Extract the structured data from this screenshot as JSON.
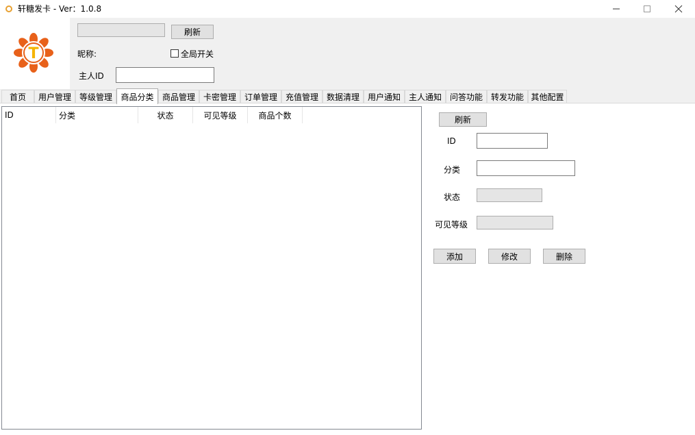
{
  "window": {
    "title": "轩糖发卡 - Ver：1.0.8",
    "minimize_icon": "minimize-icon",
    "maximize_icon": "maximize-icon",
    "close_icon": "close-icon"
  },
  "header": {
    "logo_letter": "T",
    "account_select": "",
    "refresh_label": "刷新",
    "nickname_label": "昵称:",
    "global_switch_label": "全局开关",
    "global_switch_checked": false,
    "owner_id_label": "主人ID",
    "owner_id_value": ""
  },
  "tabs": [
    {
      "label": "首页"
    },
    {
      "label": "用户管理"
    },
    {
      "label": "等级管理"
    },
    {
      "label": "商品分类"
    },
    {
      "label": "商品管理"
    },
    {
      "label": "卡密管理"
    },
    {
      "label": "订单管理"
    },
    {
      "label": "充值管理"
    },
    {
      "label": "数据清理"
    },
    {
      "label": "用户通知"
    },
    {
      "label": "主人通知"
    },
    {
      "label": "问答功能"
    },
    {
      "label": "转发功能"
    },
    {
      "label": "其他配置"
    }
  ],
  "active_tab": "商品分类",
  "table": {
    "columns": [
      "ID",
      "分类",
      "状态",
      "可见等级",
      "商品个数"
    ],
    "rows": []
  },
  "form": {
    "refresh_label": "刷新",
    "id_label": "ID",
    "id_value": "",
    "category_label": "分类",
    "category_value": "",
    "status_label": "状态",
    "status_value": "",
    "level_label": "可见等级",
    "level_value": "",
    "add_label": "添加",
    "edit_label": "修改",
    "delete_label": "删除"
  },
  "colors": {
    "logo_orange": "#e8611a",
    "logo_yellow": "#f5b400",
    "window_bg": "#f0f0f0"
  }
}
